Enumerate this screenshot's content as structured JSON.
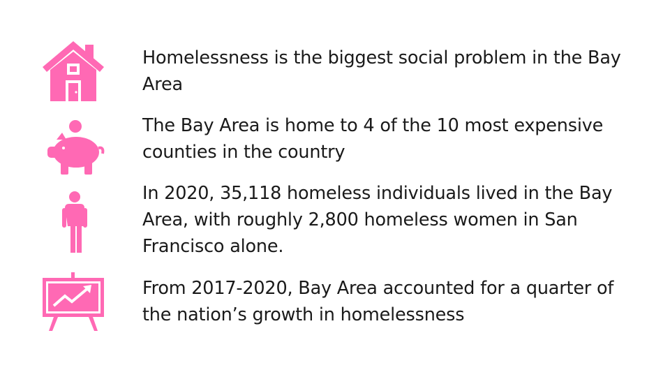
{
  "theme": {
    "accent": "#ff69b4",
    "text": "#1a1a1a",
    "background": "#ffffff"
  },
  "facts": [
    {
      "icon": "house-icon",
      "text": "Homelessness is the biggest social problem in the Bay Area"
    },
    {
      "icon": "piggy-bank-icon",
      "text": "The Bay Area is home to 4 of the 10 most expensive counties in the country"
    },
    {
      "icon": "person-icon",
      "text": "In 2020, 35,118 homeless individuals lived in the Bay Area, with roughly 2,800 homeless women in San Francisco alone."
    },
    {
      "icon": "growth-chart-easel-icon",
      "text": "From 2017-2020, Bay Area accounted for a quarter of the nation’s growth in homelessness"
    }
  ]
}
